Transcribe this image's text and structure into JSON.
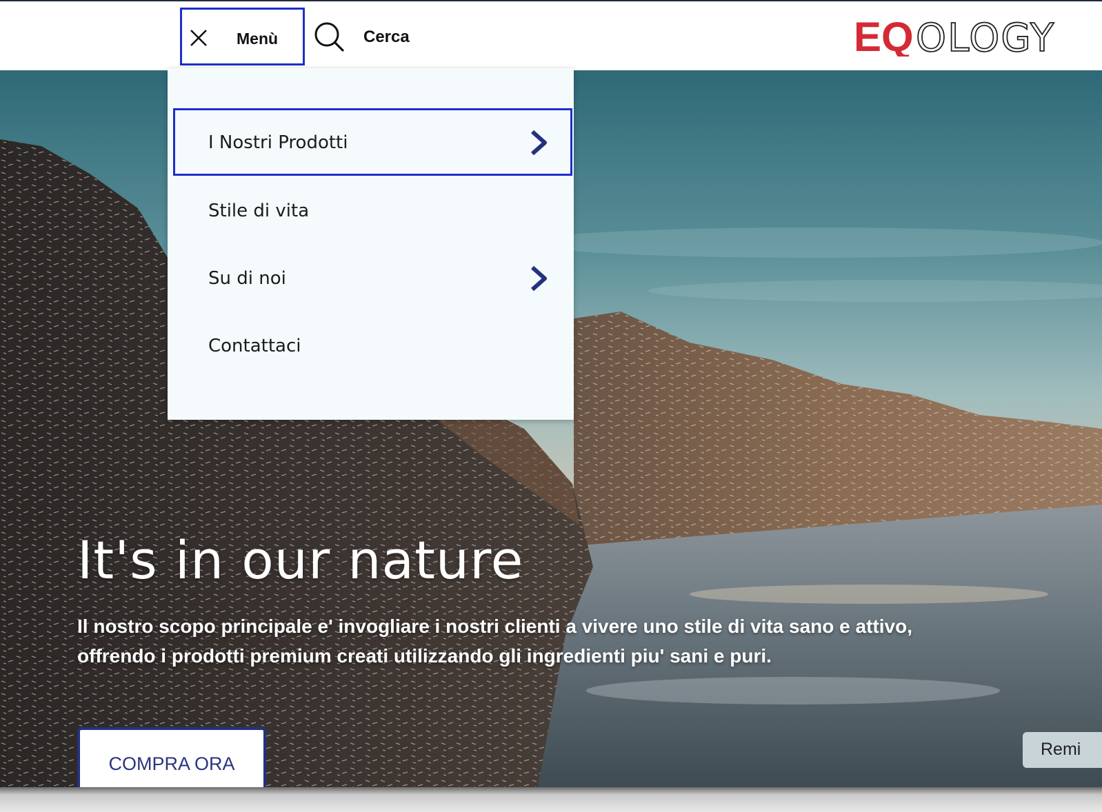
{
  "header": {
    "menu_label": "Menù",
    "search_label": "Cerca",
    "logo": {
      "red_part": "EQ",
      "grey_part": "OLOGY",
      "red_color": "#d42a35",
      "grey_color": "#222222"
    }
  },
  "menu": {
    "items": [
      {
        "label": "I Nostri Prodotti",
        "has_submenu": true,
        "focused": true
      },
      {
        "label": "Stile di vita",
        "has_submenu": false,
        "focused": false
      },
      {
        "label": "Su di noi",
        "has_submenu": true,
        "focused": false
      },
      {
        "label": "Contattaci",
        "has_submenu": false,
        "focused": false
      }
    ]
  },
  "hero": {
    "title": "It's in our nature",
    "text": "Il nostro scopo principale e' invogliare i nostri clienti a vivere uno stile di vita sano e attivo, offrendo i prodotti premium creati utilizzando gli ingredienti piu' sani e puri.",
    "cta_label": "COMPRA ORA",
    "reminder_label": "Remi"
  },
  "colors": {
    "focus_outline": "#1c2fc9",
    "chevron": "#25317f",
    "cta_border": "#25317f"
  }
}
